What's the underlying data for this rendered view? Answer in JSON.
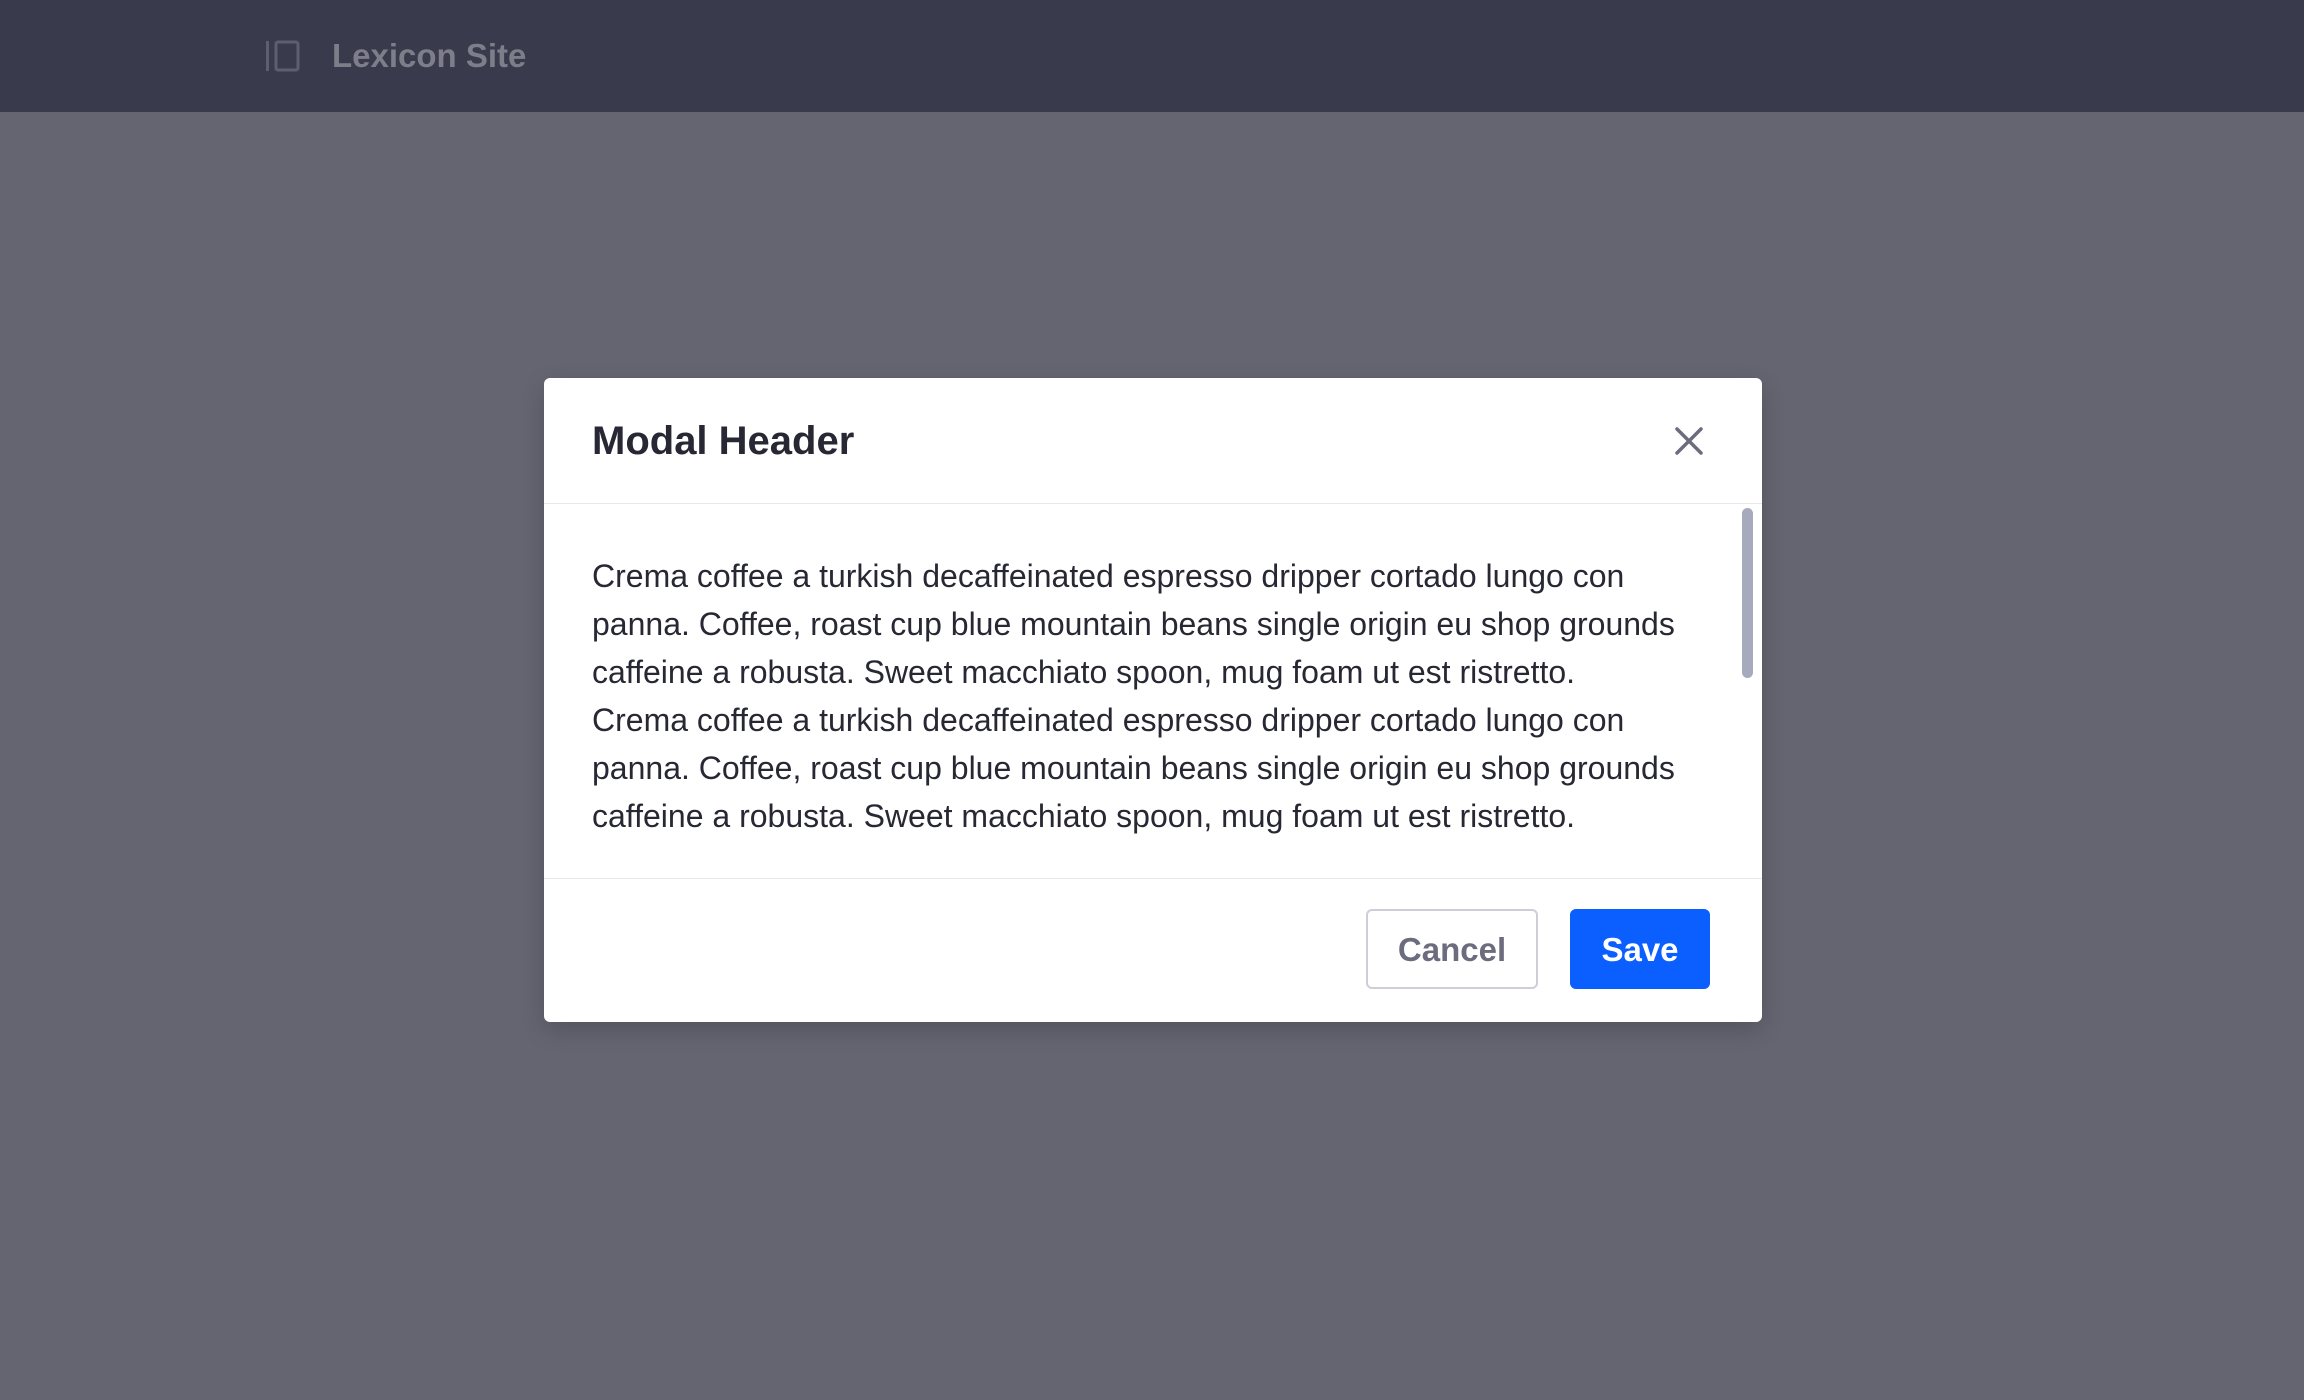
{
  "topbar": {
    "site_title": "Lexicon Site",
    "toggle_icon": "sidebar-panel-icon"
  },
  "modal": {
    "title": "Modal Header",
    "close_icon": "close-icon",
    "body": {
      "paragraphs": [
        "Crema coffee a turkish decaffeinated espresso dripper cortado lungo con panna. Coffee, roast cup blue mountain beans single origin eu shop grounds caffeine a robusta. Sweet macchiato spoon, mug foam ut est ristretto.",
        "Crema coffee a turkish decaffeinated espresso dripper cortado lungo con panna. Coffee, roast cup blue mountain beans single origin eu shop grounds caffeine a robusta. Sweet macchiato spoon, mug foam ut est ristretto."
      ]
    },
    "footer": {
      "cancel_label": "Cancel",
      "save_label": "Save"
    }
  },
  "colors": {
    "topbar_bg": "#393b4d",
    "backdrop": "#656572",
    "primary": "#0b5fff",
    "title_text": "#272833",
    "secondary_text": "#6b6c7e",
    "scrollbar": "#a7a9bc"
  }
}
